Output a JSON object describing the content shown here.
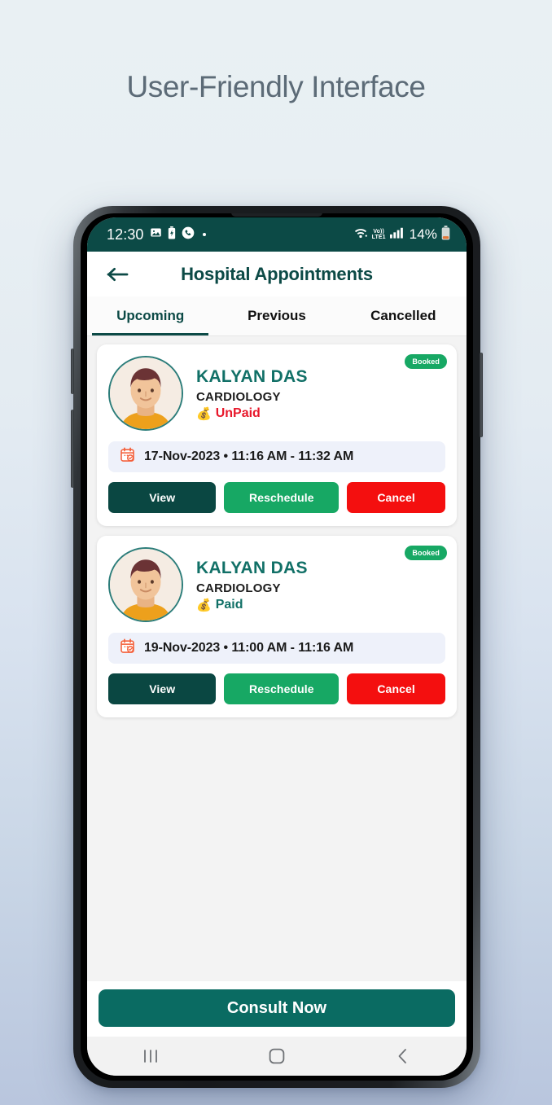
{
  "headline": "User-Friendly Interface",
  "statusbar": {
    "time": "12:30",
    "icons_left": [
      "image-icon",
      "battery-saver-icon",
      "call-icon",
      "dot-icon"
    ],
    "network_label_top": "Vo))",
    "network_label_bottom": "LTE1",
    "battery_percent": "14%",
    "icons_right": [
      "wifi-icon",
      "volte-icon",
      "signal-icon",
      "battery-icon"
    ],
    "bg_color": "#0c4a46"
  },
  "appbar": {
    "back_icon": "arrow-left-icon",
    "title": "Hospital Appointments"
  },
  "tabs": [
    {
      "label": "Upcoming",
      "active": true
    },
    {
      "label": "Previous",
      "active": false
    },
    {
      "label": "Cancelled",
      "active": false
    }
  ],
  "cards": [
    {
      "badge": "Booked",
      "avatar": "patient-avatar",
      "name": "KALYAN DAS",
      "department": "CARDIOLOGY",
      "payment_emoji": "💰",
      "payment_status": "UnPaid",
      "payment_state": "unpaid",
      "calendar_icon": "calendar-icon",
      "datetime": "17-Nov-2023 • 11:16 AM - 11:32 AM",
      "buttons": {
        "view": "View",
        "reschedule": "Reschedule",
        "cancel": "Cancel"
      }
    },
    {
      "badge": "Booked",
      "avatar": "patient-avatar",
      "name": "KALYAN DAS",
      "department": "CARDIOLOGY",
      "payment_emoji": "💰",
      "payment_status": "Paid",
      "payment_state": "paid",
      "calendar_icon": "calendar-icon",
      "datetime": "19-Nov-2023 • 11:00 AM - 11:16 AM",
      "buttons": {
        "view": "View",
        "reschedule": "Reschedule",
        "cancel": "Cancel"
      }
    }
  ],
  "cta": {
    "label": "Consult Now"
  },
  "navbar": {
    "recents_icon": "recents-icon",
    "home_icon": "home-icon",
    "back_icon": "back-chevron-icon"
  },
  "colors": {
    "brand_dark": "#0c4a46",
    "brand_green": "#17a864",
    "danger": "#f40f0f",
    "view_dark": "#0a4742",
    "cta": "#0a6b62",
    "name_teal": "#117067",
    "unpaid_red": "#e8192c"
  }
}
